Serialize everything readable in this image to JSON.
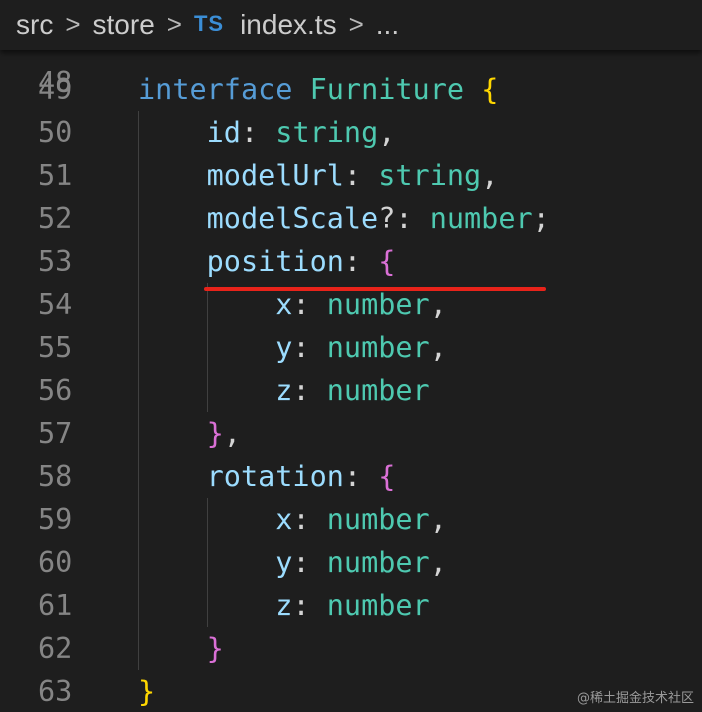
{
  "breadcrumb": {
    "items": [
      "src",
      "store",
      "index.ts",
      "..."
    ],
    "file_icon": "TS",
    "separator": ">"
  },
  "editor": {
    "partial_line_number": "48",
    "lines": [
      {
        "number": "49",
        "tokens": [
          [
            "kw",
            "interface "
          ],
          [
            "type",
            "Furniture "
          ],
          [
            "brace1",
            "{"
          ]
        ]
      },
      {
        "number": "50",
        "tokens": [
          [
            "prop",
            "    id"
          ],
          [
            "punc",
            ": "
          ],
          [
            "type",
            "string"
          ],
          [
            "punc",
            ","
          ]
        ]
      },
      {
        "number": "51",
        "tokens": [
          [
            "prop",
            "    modelUrl"
          ],
          [
            "punc",
            ": "
          ],
          [
            "type",
            "string"
          ],
          [
            "punc",
            ","
          ]
        ]
      },
      {
        "number": "52",
        "tokens": [
          [
            "prop",
            "    modelScale"
          ],
          [
            "punc",
            "?: "
          ],
          [
            "type",
            "number"
          ],
          [
            "punc",
            ";"
          ]
        ]
      },
      {
        "number": "53",
        "tokens": [
          [
            "prop",
            "    position"
          ],
          [
            "punc",
            ": "
          ],
          [
            "brace2",
            "{"
          ]
        ]
      },
      {
        "number": "54",
        "tokens": [
          [
            "prop",
            "        x"
          ],
          [
            "punc",
            ": "
          ],
          [
            "type",
            "number"
          ],
          [
            "punc",
            ","
          ]
        ]
      },
      {
        "number": "55",
        "tokens": [
          [
            "prop",
            "        y"
          ],
          [
            "punc",
            ": "
          ],
          [
            "type",
            "number"
          ],
          [
            "punc",
            ","
          ]
        ]
      },
      {
        "number": "56",
        "tokens": [
          [
            "prop",
            "        z"
          ],
          [
            "punc",
            ": "
          ],
          [
            "type",
            "number"
          ]
        ]
      },
      {
        "number": "57",
        "tokens": [
          [
            "brace2",
            "    }"
          ],
          [
            "punc",
            ","
          ]
        ]
      },
      {
        "number": "58",
        "tokens": [
          [
            "prop",
            "    rotation"
          ],
          [
            "punc",
            ": "
          ],
          [
            "brace2",
            "{"
          ]
        ]
      },
      {
        "number": "59",
        "tokens": [
          [
            "prop",
            "        x"
          ],
          [
            "punc",
            ": "
          ],
          [
            "type",
            "number"
          ],
          [
            "punc",
            ","
          ]
        ]
      },
      {
        "number": "60",
        "tokens": [
          [
            "prop",
            "        y"
          ],
          [
            "punc",
            ": "
          ],
          [
            "type",
            "number"
          ],
          [
            "punc",
            ","
          ]
        ]
      },
      {
        "number": "61",
        "tokens": [
          [
            "prop",
            "        z"
          ],
          [
            "punc",
            ": "
          ],
          [
            "type",
            "number"
          ]
        ]
      },
      {
        "number": "62",
        "tokens": [
          [
            "brace2",
            "    }"
          ]
        ]
      },
      {
        "number": "63",
        "tokens": [
          [
            "brace1",
            "}"
          ]
        ]
      }
    ]
  },
  "annotation": {
    "underline_color": "#e8231a",
    "underlined_line": "52"
  },
  "watermark": "@稀土掘金技术社区",
  "colors": {
    "background": "#1e1e1e",
    "keyword": "#569cd6",
    "type": "#4ec9b0",
    "property": "#9cdcfe",
    "punctuation": "#d4d4d4",
    "brace_outer": "#ffd700",
    "brace_inner": "#da70d6",
    "line_number": "#858585"
  }
}
